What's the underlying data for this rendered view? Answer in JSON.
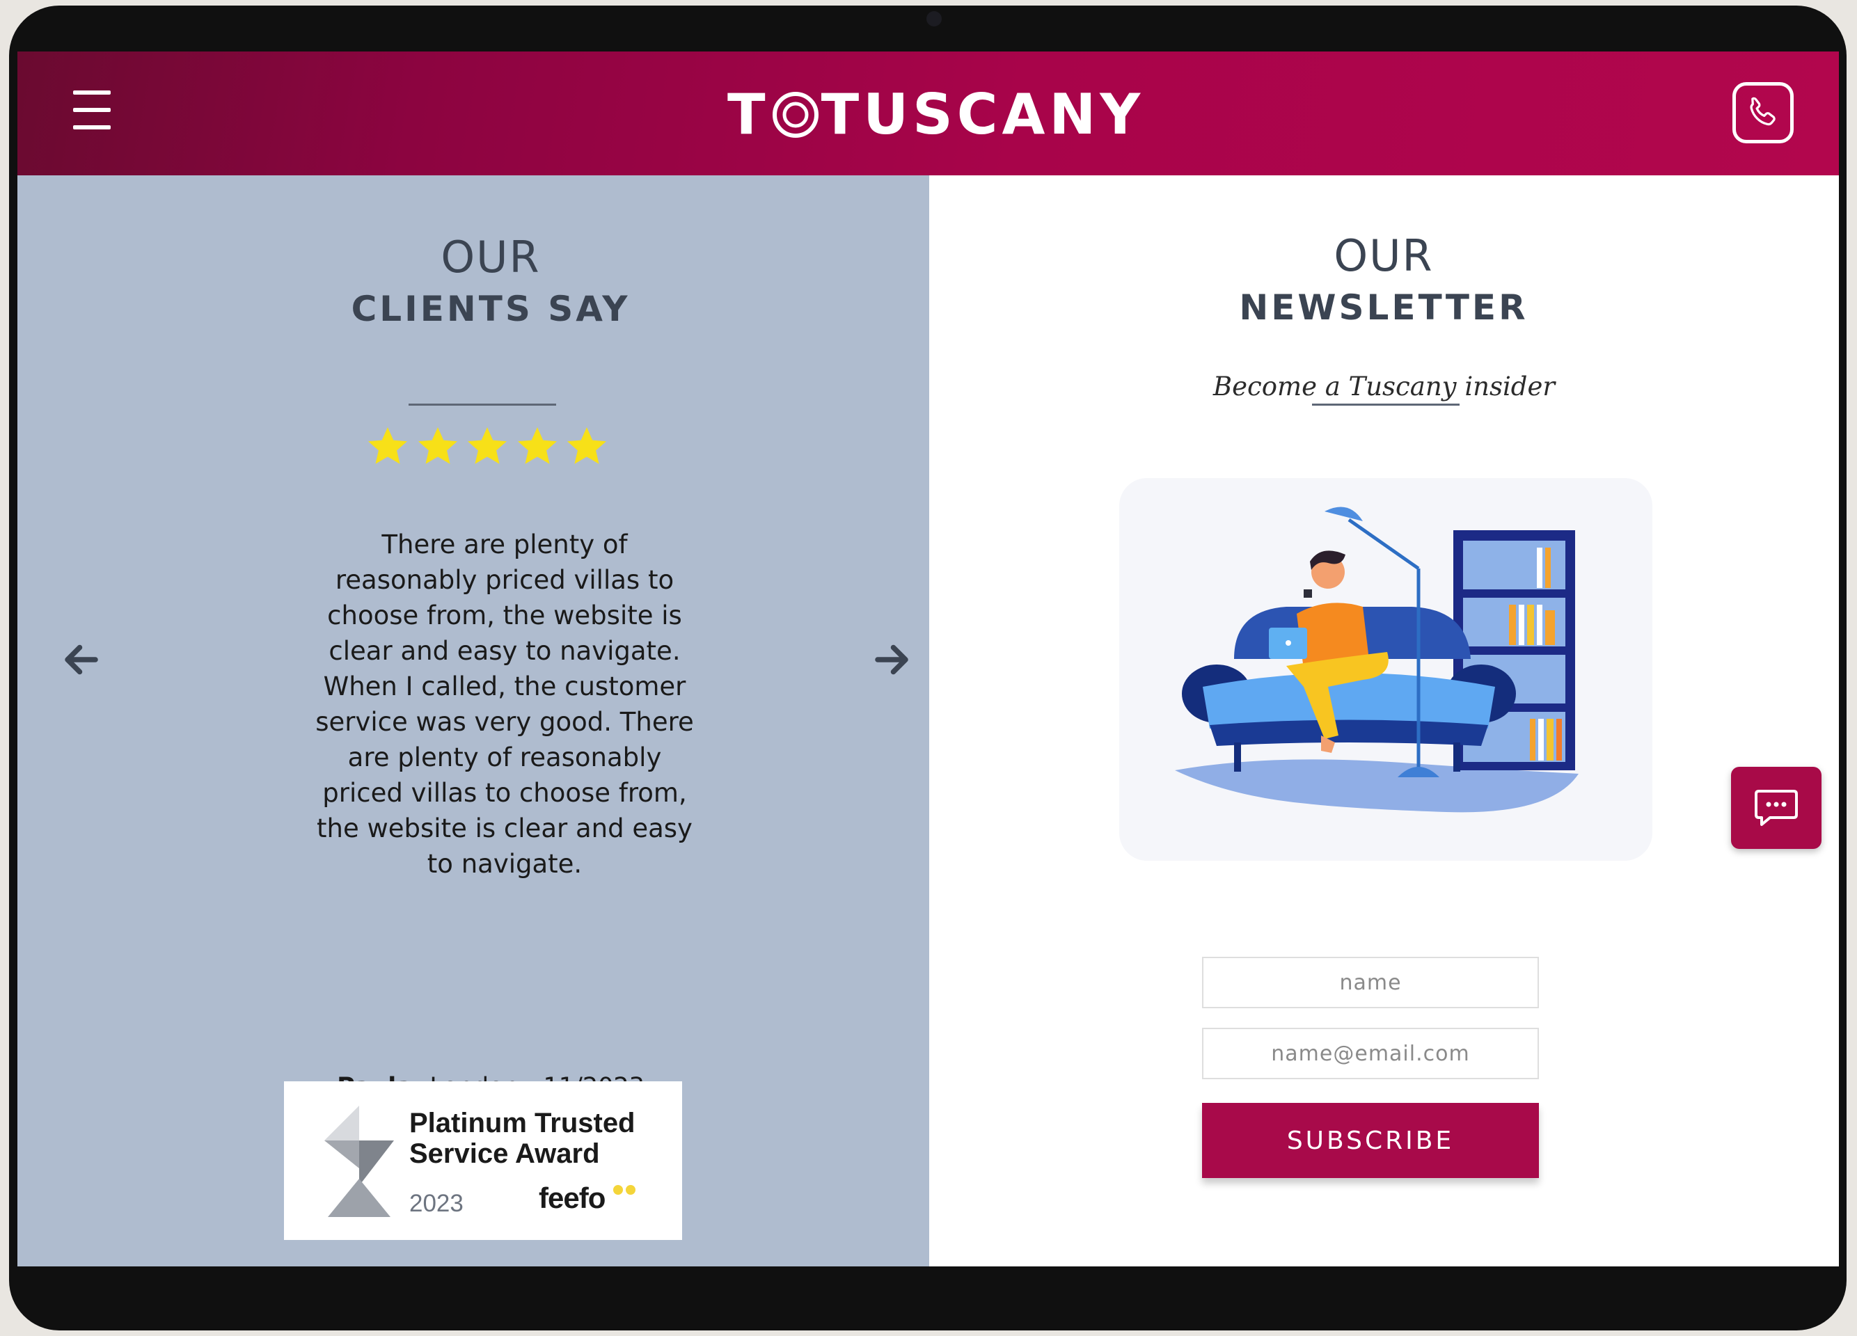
{
  "header": {
    "brand_pre": "T",
    "brand_post": "TUSCANY",
    "menu_icon": "hamburger-menu-icon",
    "phone_icon": "phone-icon",
    "colors": {
      "header_start": "#6a0a30",
      "header_end": "#b2064d"
    }
  },
  "testimonials": {
    "heading_line1": "OUR",
    "heading_line2": "CLIENTS SAY",
    "rating": 5,
    "rating_max": 5,
    "quote": "There are plenty of reasonably priced villas to choose from, the website is clear and easy to navigate. When I called, the customer service was very good. There are plenty of reasonably priced villas to choose from, the website is clear and easy to navigate.",
    "author": "Paula,",
    "location_date": " London - 11/2023",
    "prev_icon": "arrow-left-icon",
    "next_icon": "arrow-right-icon",
    "background": "#afbccf"
  },
  "award": {
    "title_line1": "Platinum Trusted",
    "title_line2": "Service Award",
    "year": "2023",
    "brand": "feefo"
  },
  "newsletter": {
    "heading_line1": "OUR",
    "heading_line2": "NEWSLETTER",
    "subtitle": "Become a Tuscany insider",
    "name_placeholder": "name",
    "email_placeholder": "name@email.com",
    "subscribe_label": "SUBSCRIBE",
    "accent": "#a80a4a"
  },
  "chat": {
    "icon": "chat-bubble-icon"
  }
}
